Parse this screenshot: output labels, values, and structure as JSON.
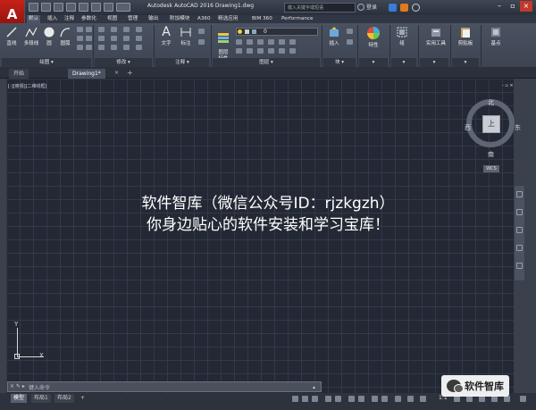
{
  "app": {
    "logo_letter": "A",
    "title": "Autodesk AutoCAD 2016    Drawing1.dwg",
    "search_placeholder": "键入关键字或短语",
    "login": "登录"
  },
  "menu_tabs": [
    "默认",
    "插入",
    "注释",
    "参数化",
    "视图",
    "管理",
    "输出",
    "附加模块",
    "A360",
    "精选应用",
    "BIM 360",
    "Performance"
  ],
  "ribbon": {
    "draw_buttons": [
      "直线",
      "多段线",
      "圆",
      "圆弧"
    ],
    "modify_icons": [
      "move-icon",
      "rotate-icon",
      "trim-icon",
      "copy-icon",
      "mirror-icon",
      "fillet-icon",
      "stretch-icon",
      "scale-icon",
      "array-icon"
    ],
    "annotation_buttons": [
      "文字",
      "标注"
    ],
    "layer_button": "图层\n特性",
    "layer_value": "0",
    "block_button": "插入",
    "properties_button": "特性",
    "group_button": "组",
    "utilities_button": "实用工具",
    "clipboard_button": "剪贴板",
    "base_button": "基点",
    "panel_labels": [
      "绘图 ▾",
      "修改 ▾",
      "注释 ▾",
      "图层 ▾",
      "块 ▾",
      "▾",
      "▾",
      "▾",
      "▾"
    ]
  },
  "doc_tabs": [
    "开始",
    "Drawing1*"
  ],
  "viewport": {
    "label": "[-][俯视][二维线框]",
    "controls": "- ▫ ×"
  },
  "viewcube": {
    "face": "上",
    "north": "北",
    "south": "南",
    "east": "东",
    "west": "西",
    "wcs": "WCS"
  },
  "watermark": {
    "line1": "软件智库（微信公众号ID：rjzkgzh）",
    "line2": "你身边贴心的软件安装和学习宝库！"
  },
  "ucs": {
    "x": "X",
    "y": "Y"
  },
  "command_line": {
    "placeholder": "键入命令",
    "prompt_icons": "× ✎ ▸"
  },
  "layout_tabs": [
    "模型",
    "布局1",
    "布局2",
    "+"
  ],
  "status": {
    "scale": "1:1"
  },
  "brand": {
    "name": "软件智库"
  },
  "colors": {
    "ribbon_bg": "#454c5a",
    "canvas_bg": "#232834",
    "accent_red": "#c8201a"
  }
}
